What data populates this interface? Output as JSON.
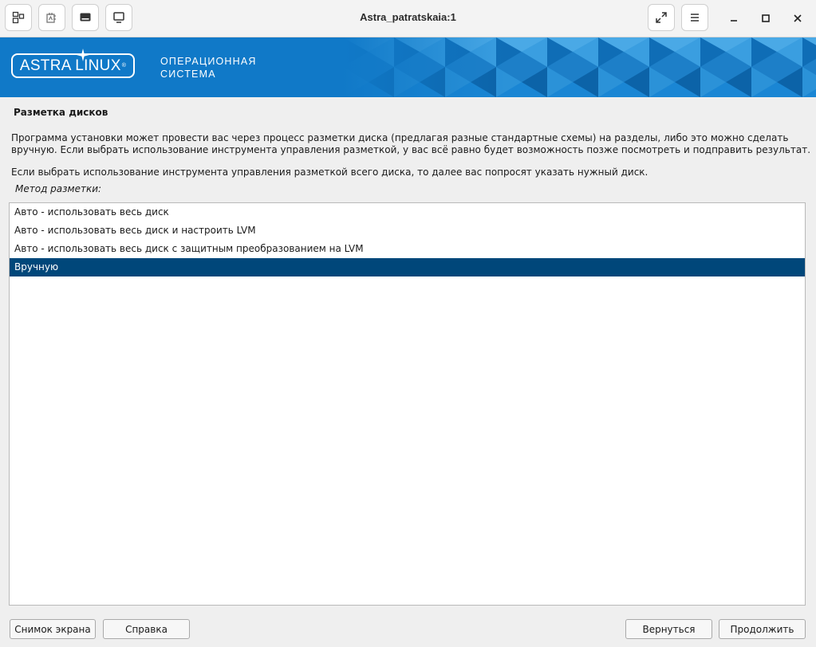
{
  "window": {
    "title": "Astra_patratskaia:1"
  },
  "toolbar": {
    "buttons": [
      {
        "icon": "windows-icon"
      },
      {
        "icon": "devices-icon"
      },
      {
        "icon": "console-icon"
      },
      {
        "icon": "monitor-icon"
      }
    ],
    "right_buttons": [
      {
        "icon": "fullscreen-icon"
      },
      {
        "icon": "menu-icon"
      }
    ]
  },
  "banner": {
    "logo_text": "ASTRA LINUX",
    "logo_reg": "®",
    "tagline_line1": "ОПЕРАЦИОННАЯ",
    "tagline_line2": "СИСТЕМА",
    "bg_color": "#1079c8"
  },
  "page": {
    "heading": "Разметка дисков",
    "paragraph1_line1": "Программа установки может провести вас через процесс разметки диска (предлагая разные стандартные схемы) на разделы, либо это можно сделать",
    "paragraph1_line2": "вручную. Если выбрать использование инструмента управления разметкой, у вас всё равно будет возможность позже посмотреть и подправить результат.",
    "paragraph2": "Если выбрать использование инструмента управления разметкой всего диска, то далее вас попросят указать нужный диск.",
    "method_label": "Метод разметки:",
    "options": [
      {
        "label": "Авто - использовать весь диск",
        "selected": false
      },
      {
        "label": "Авто - использовать весь диск и настроить LVM",
        "selected": false
      },
      {
        "label": "Авто - использовать весь диск с защитным преобразованием на LVM",
        "selected": false
      },
      {
        "label": "Вручную",
        "selected": true
      }
    ],
    "selection_color": "#00477a"
  },
  "footer": {
    "screenshot_label": "Снимок экрана",
    "help_label": "Справка",
    "back_label": "Вернуться",
    "continue_label": "Продолжить"
  }
}
